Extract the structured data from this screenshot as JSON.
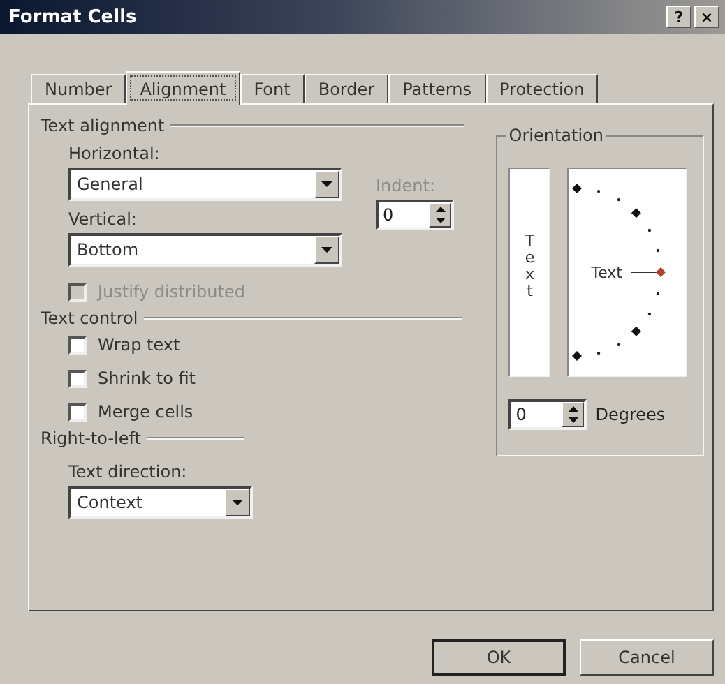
{
  "window": {
    "title": "Format Cells",
    "title_buttons": [
      "?",
      "×"
    ]
  },
  "tabs": [
    {
      "label": "Number",
      "selected": false
    },
    {
      "label": "Alignment",
      "selected": true
    },
    {
      "label": "Font",
      "selected": false
    },
    {
      "label": "Border",
      "selected": false
    },
    {
      "label": "Patterns",
      "selected": false
    },
    {
      "label": "Protection",
      "selected": false
    }
  ],
  "text_alignment": {
    "legend": "Text alignment",
    "horizontal": {
      "label": "Horizontal:",
      "value": "General"
    },
    "vertical": {
      "label": "Vertical:",
      "value": "Bottom"
    },
    "indent": {
      "label": "Indent:",
      "value": "0",
      "disabled": true
    },
    "justify_distributed": {
      "label": "Justify distributed",
      "checked": false,
      "disabled": true
    }
  },
  "text_control": {
    "legend": "Text control",
    "options": [
      {
        "label": "Wrap text",
        "checked": false
      },
      {
        "label": "Shrink to fit",
        "checked": false
      },
      {
        "label": "Merge cells",
        "checked": false
      }
    ]
  },
  "right_to_left": {
    "legend": "Right-to-left",
    "text_direction": {
      "label": "Text direction:",
      "value": "Context"
    }
  },
  "orientation": {
    "legend": "Orientation",
    "vertical_text": "Text",
    "dial_text": "Text",
    "degrees": {
      "value": "0",
      "label": "Degrees"
    }
  },
  "buttons": [
    {
      "label": "OK",
      "default": true
    },
    {
      "label": "Cancel",
      "default": false
    }
  ]
}
